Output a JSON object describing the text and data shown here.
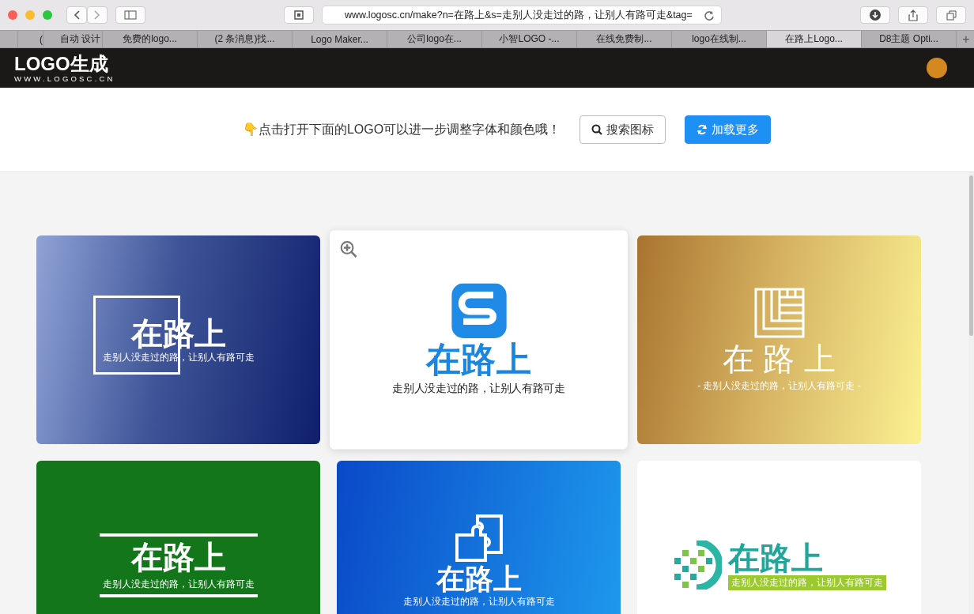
{
  "browser": {
    "url": "www.logosc.cn/make?n=在路上&s=走别人没走过的路，让别人有路可走&tag=",
    "new_tab": "+",
    "tabs": [
      {
        "selected": false
      },
      {
        "label": "(",
        "selected": false
      },
      {
        "label": "自动 设计",
        "selected": false
      },
      {
        "label": "免费的logo...",
        "selected": false
      },
      {
        "label": "(2 条消息)找...",
        "selected": false
      },
      {
        "label": "Logo Maker...",
        "selected": false
      },
      {
        "label": "公司logo在...",
        "selected": false
      },
      {
        "label": "小智LOGO -...",
        "selected": false
      },
      {
        "label": "在线免费制...",
        "selected": false
      },
      {
        "label": "logo在线制...",
        "selected": false
      },
      {
        "label": "在路上Logo...",
        "selected": true
      },
      {
        "label": "D8主题 Opti...",
        "selected": false
      }
    ]
  },
  "site": {
    "logo": "LOGO生成",
    "domain": "WWW.LOGOSC.CN"
  },
  "toolbar": {
    "hint": "👇点击打开下面的LOGO可以进一步调整字体和颜色哦！",
    "search_button": "搜索图标",
    "load_button": "加载更多"
  },
  "cards": [
    {
      "kind": "frame",
      "name": "在路上",
      "slogan": "走别人没走过的路，让别人有路可走",
      "hovered": false
    },
    {
      "kind": "badge",
      "name": "在路上",
      "slogan": "走别人没走过的路，让别人有路可走",
      "hovered": true
    },
    {
      "kind": "seal",
      "name": "在 路 上",
      "slogan": "- 走别人没走过的路，让别人有路可走 -",
      "hovered": false
    },
    {
      "kind": "lines",
      "name": "在路上",
      "slogan": "走别人没走过的路，让别人有路可走",
      "hovered": false
    },
    {
      "kind": "puzzle",
      "name": "在路上",
      "slogan": "走别人没走过的路，让别人有路可走",
      "hovered": false
    },
    {
      "kind": "pixel",
      "name": "在路上",
      "slogan": "走别人没走过的路，让别人有路可走",
      "hovered": false
    }
  ]
}
